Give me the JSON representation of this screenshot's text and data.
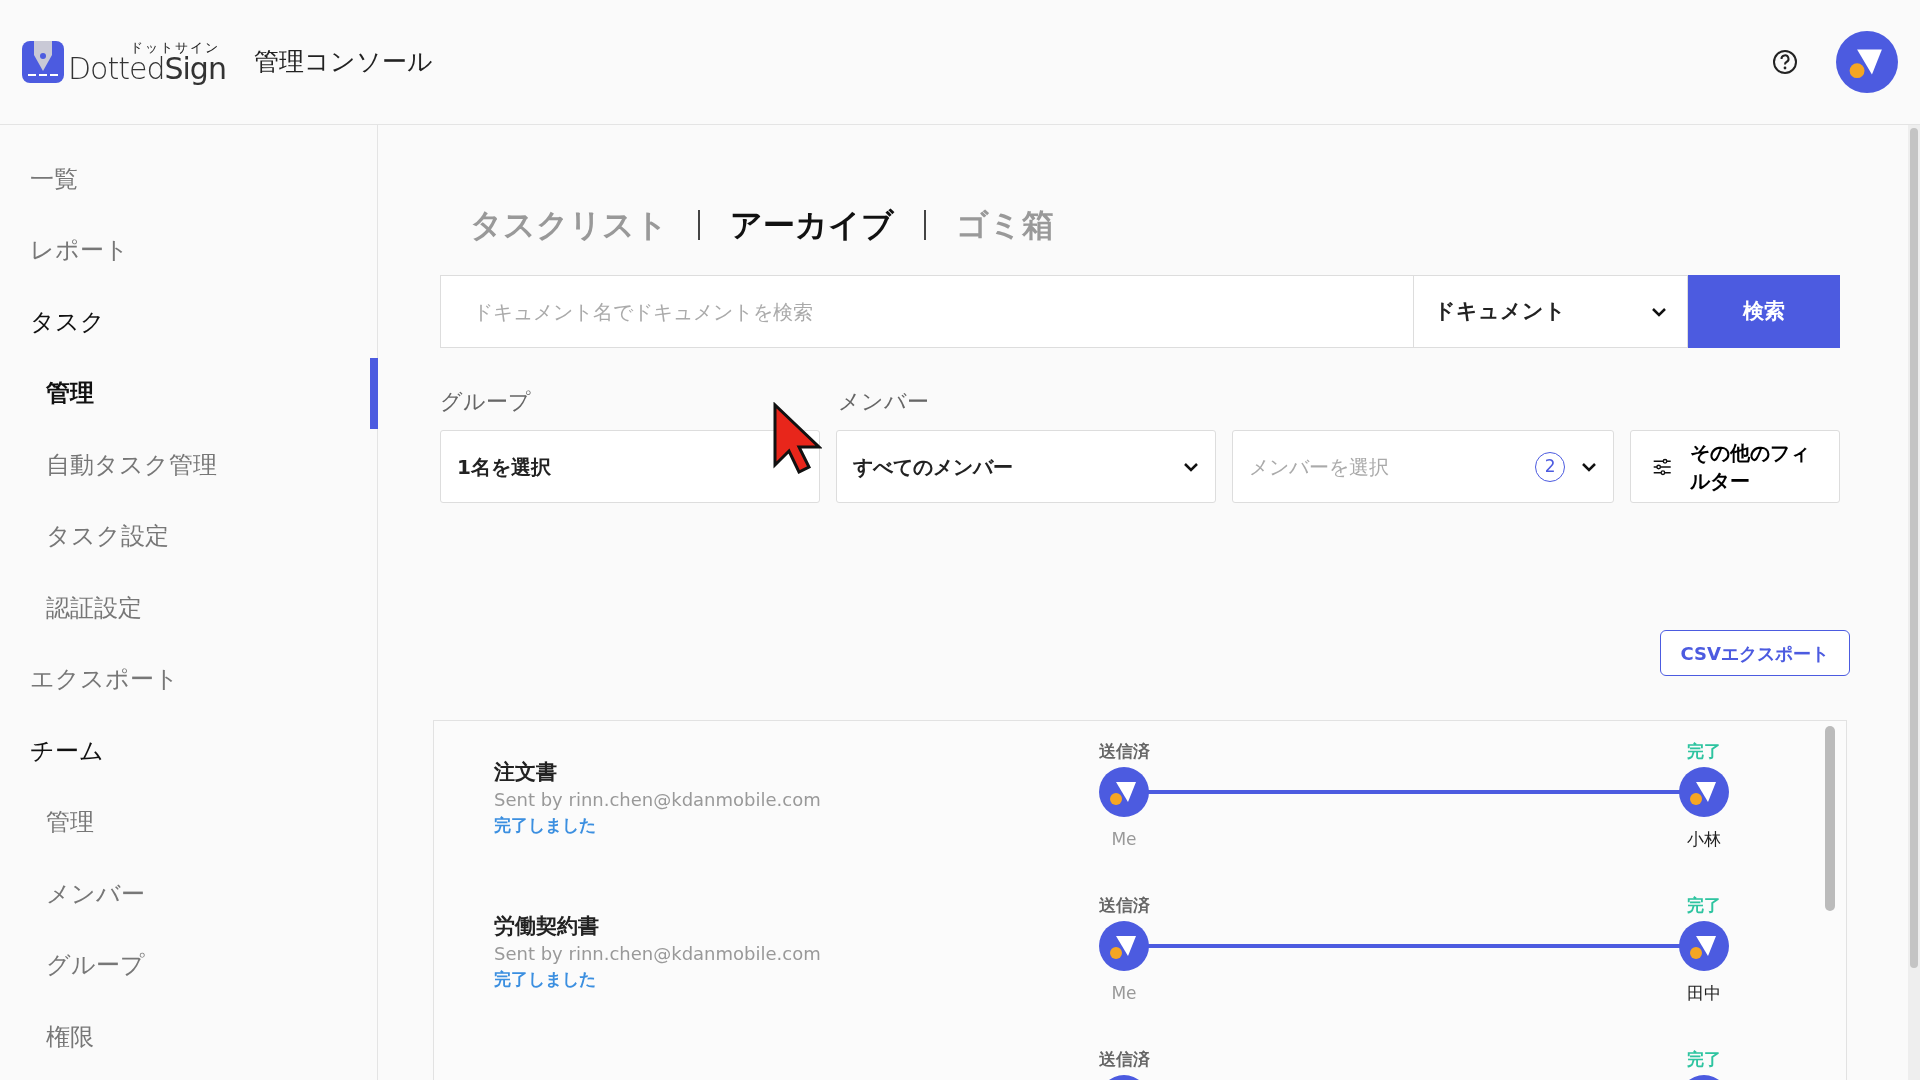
{
  "header": {
    "logo": {
      "kana": "ドットサイン",
      "wordmark": "Dotted**Sign**"
    },
    "title": "管理コンソール"
  },
  "sidebar": {
    "items": [
      {
        "label": "一覧",
        "kind": "link",
        "selected": false
      },
      {
        "label": "レポート",
        "kind": "link",
        "selected": false
      },
      {
        "label": "タスク",
        "kind": "group",
        "selected": false,
        "children": [
          {
            "label": "管理",
            "selected": true
          },
          {
            "label": "自動タスク管理",
            "selected": false
          },
          {
            "label": "タスク設定",
            "selected": false
          },
          {
            "label": "認証設定",
            "selected": false
          }
        ]
      },
      {
        "label": "エクスポート",
        "kind": "link",
        "selected": false
      },
      {
        "label": "チーム",
        "kind": "group",
        "selected": false,
        "children": [
          {
            "label": "管理",
            "selected": false
          },
          {
            "label": "メンバー",
            "selected": false
          },
          {
            "label": "グループ",
            "selected": false
          },
          {
            "label": "権限",
            "selected": false
          }
        ]
      }
    ]
  },
  "tabs": [
    {
      "label": "タスクリスト",
      "selected": false
    },
    {
      "label": "アーカイブ",
      "selected": true
    },
    {
      "label": "ゴミ箱",
      "selected": false
    }
  ],
  "search": {
    "placeholder": "ドキュメント名でドキュメントを検索",
    "scope": "ドキュメント",
    "button": "検索"
  },
  "filters": {
    "group_label": "グループ",
    "group_value": "1名を選択",
    "member_label": "メンバー",
    "member_scope": "すべてのメンバー",
    "member_placeholder": "メンバーを選択",
    "member_count": "2",
    "more": "その他のフィルター"
  },
  "export_button": "CSVエクスポート",
  "tasks": [
    {
      "title": "注文書",
      "sender": "Sent by rinn.chen@kdanmobile.com",
      "status": "完了しました",
      "signers": [
        {
          "kind": "sent",
          "state": "送信済",
          "name": "Me"
        },
        {
          "kind": "done",
          "state": "完了",
          "name": "小林"
        }
      ]
    },
    {
      "title": "労働契約書",
      "sender": "Sent by rinn.chen@kdanmobile.com",
      "status": "完了しました",
      "signers": [
        {
          "kind": "sent",
          "state": "送信済",
          "name": "Me"
        },
        {
          "kind": "done",
          "state": "完了",
          "name": "田中"
        }
      ]
    },
    {
      "signers": [
        {
          "kind": "sent",
          "state": "送信済"
        },
        {
          "kind": "done",
          "state": "完了"
        }
      ]
    }
  ]
}
